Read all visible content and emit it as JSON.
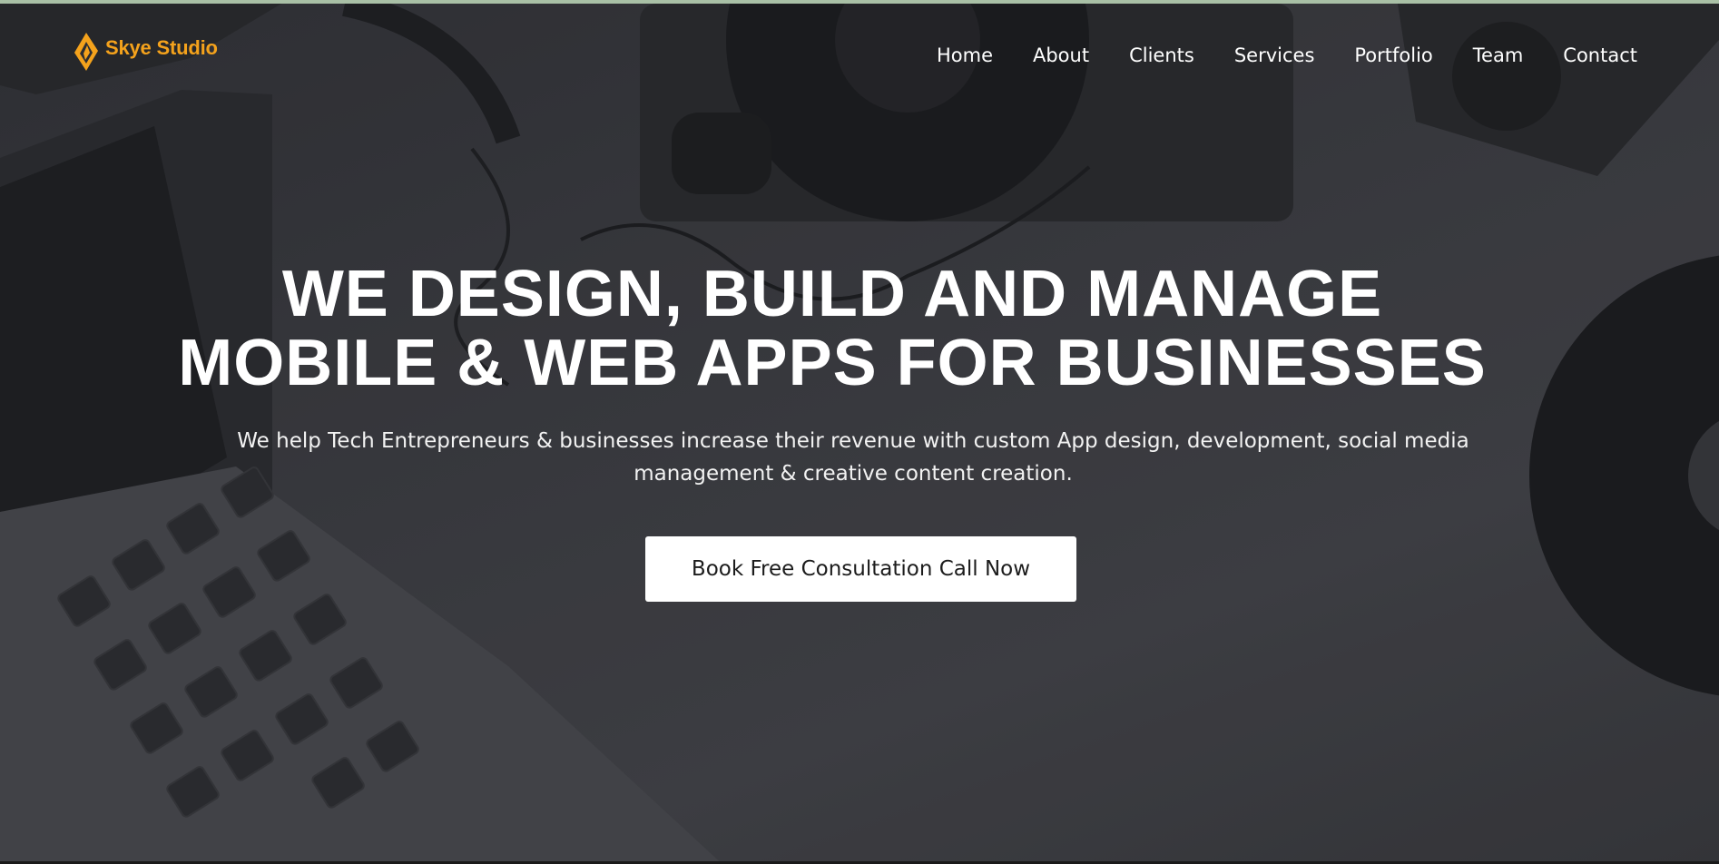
{
  "brand": {
    "name": "Skye Studio",
    "color": "#f4a21c"
  },
  "nav": {
    "items": [
      {
        "label": "Home"
      },
      {
        "label": "About"
      },
      {
        "label": "Clients"
      },
      {
        "label": "Services"
      },
      {
        "label": "Portfolio"
      },
      {
        "label": "Team"
      },
      {
        "label": "Contact"
      }
    ]
  },
  "hero": {
    "headline_line1": "WE DESIGN, BUILD AND MANAGE",
    "headline_line2": "MOBILE & WEB APPS FOR BUSINESSES",
    "subtext": "We help Tech Entrepreneurs & businesses increase their revenue with custom App design, development, social media management & creative content creation.",
    "cta_label": "Book Free Consultation Call Now"
  },
  "background": {
    "description_icons": [
      "laptop-icon",
      "headphones-icon",
      "turntable-icon",
      "vinyl-record-icon",
      "speaker-icon"
    ]
  }
}
